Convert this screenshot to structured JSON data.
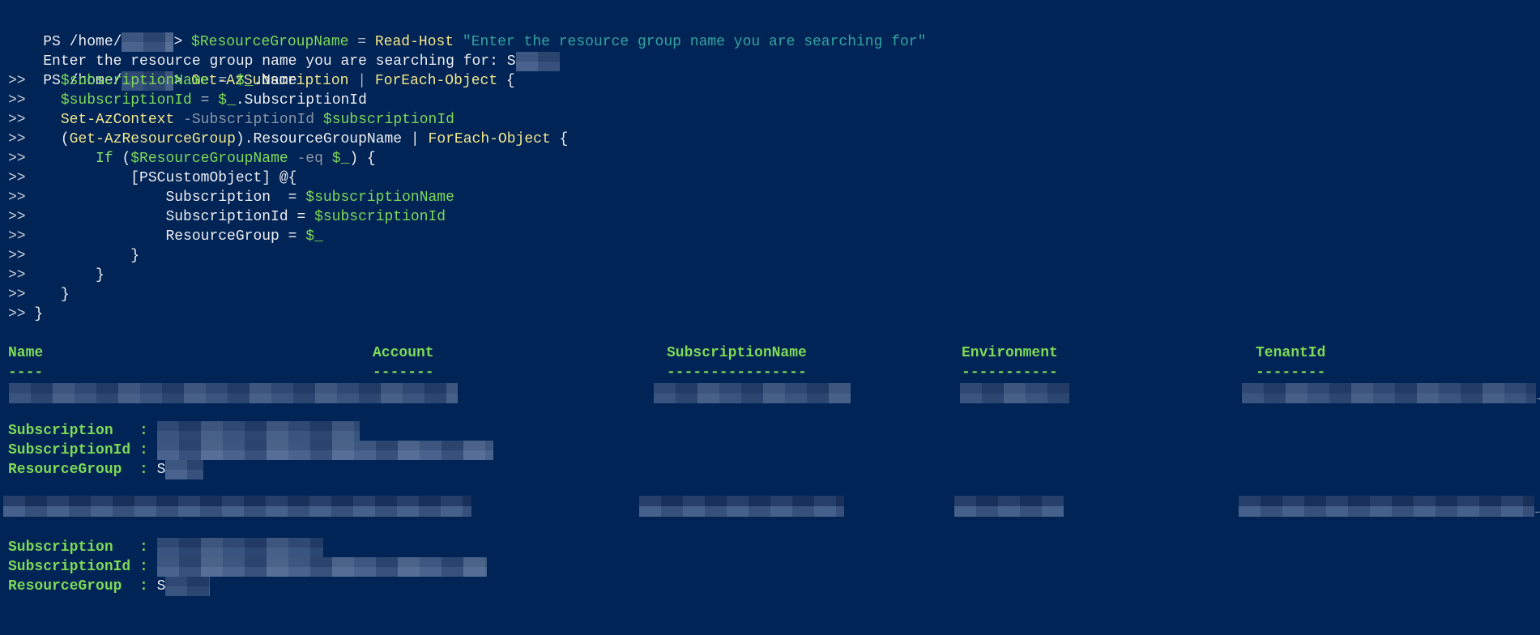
{
  "window": {
    "app": "PowerShell",
    "background": "#012456"
  },
  "colors": {
    "variable": "#7ed957",
    "command": "#f3e68a",
    "string": "#33a3a0",
    "parameter": "#8c95a5",
    "text": "#eeedf0"
  },
  "prompt": {
    "prefix": "PS /home/",
    "suffix": "> ",
    "continuation": ">>"
  },
  "line1": {
    "var": "$ResourceGroupName",
    "eq": " = ",
    "cmd": "Read-Host",
    "sp": " ",
    "str": "\"Enter the resource group name you are searching for\""
  },
  "line2": {
    "text": "Enter the resource group name you are searching for: ",
    "answer_visible": "S"
  },
  "line3": {
    "cmd1": "Get-AzSubscription",
    "pipe": " | ",
    "cmd2": "ForEach-Object",
    "brace": " {"
  },
  "code": {
    "l4_var": "$subscriptionName",
    "l4_eq": " = ",
    "l4_val_var": "$_",
    "l4_prop": ".Name",
    "l5_var": "$subscriptionId",
    "l5_eq": " = ",
    "l5_val_var": "$_",
    "l5_prop": ".SubscriptionId",
    "l6_cmd": "Set-AzContext",
    "l6_param": " -SubscriptionId ",
    "l6_var": "$subscriptionId",
    "l7_open": "(",
    "l7_cmd": "Get-AzResourceGroup",
    "l7_rest": ").ResourceGroupName | ",
    "l7_cmd2": "ForEach-Object",
    "l7_brace": " {",
    "l8_kw": "If",
    "l8_open": " (",
    "l8_var": "$ResourceGroupName",
    "l8_op": " -eq ",
    "l8_var2": "$_",
    "l8_close": ") {",
    "l9_text": "[PSCustomObject] @{",
    "l10_key": "Subscription  = ",
    "l10_var": "$subscriptionName",
    "l11_key": "SubscriptionId = ",
    "l11_var": "$subscriptionId",
    "l12_key": "ResourceGroup = ",
    "l12_var": "$_",
    "close": "}",
    "last": " }"
  },
  "table": {
    "columns": [
      "Name",
      "Account",
      "SubscriptionName",
      "Environment",
      "TenantId"
    ],
    "underlines": [
      "----",
      "-------",
      "----------------",
      "-----------",
      "--------"
    ],
    "rows_redacted": 2,
    "truncation": "…"
  },
  "results": [
    {
      "labels": [
        "Subscription   : ",
        "SubscriptionId : ",
        "ResourceGroup  : "
      ],
      "resource_group_visible": "S"
    },
    {
      "labels": [
        "Subscription   : ",
        "SubscriptionId : ",
        "ResourceGroup  : "
      ],
      "resource_group_visible": "S"
    }
  ]
}
